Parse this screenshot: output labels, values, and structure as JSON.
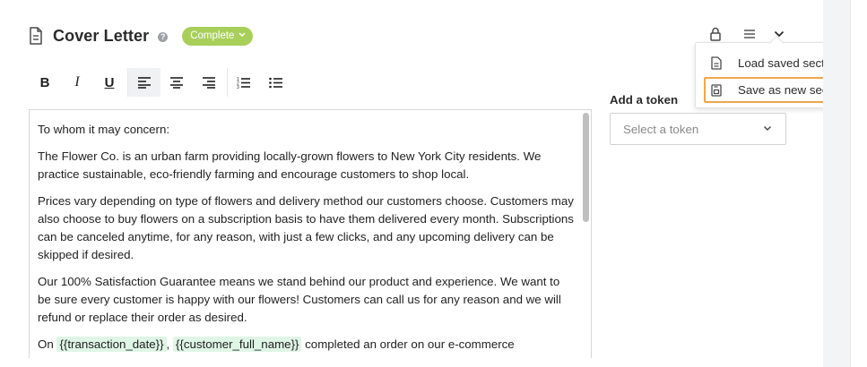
{
  "header": {
    "title": "Cover Letter",
    "help_icon": "?",
    "status": "Complete",
    "accent_color": "#a8cf5a"
  },
  "header_actions": {
    "icons": [
      "lock-icon",
      "menu-icon",
      "chevron-down-icon"
    ]
  },
  "toolbar": {
    "bold": "B",
    "italic": "I",
    "underline": "U",
    "active_tool": "align-left"
  },
  "editor": {
    "paragraphs": [
      "To whom it may concern:",
      "The Flower Co. is an urban farm providing locally-grown flowers to New York City residents. We practice sustainable, eco-friendly farming and encourage customers to shop local.",
      "Prices vary depending on type of flowers and delivery method our customers choose. Customers may also choose to buy flowers on a subscription basis to have them delivered every month. Subscriptions can be canceled anytime, for any reason, with just a few clicks, and any upcoming delivery can be skipped if desired.",
      "Our 100% Satisfaction Guarantee means we stand behind our product and experience. We want to be sure every customer is happy with our flowers! Customers can call us for any reason and we will refund or replace their order as desired."
    ],
    "last_line": {
      "lead": "On",
      "token1": "{{transaction_date}}",
      "comma": ",",
      "token2": "{{customer_full_name}}",
      "tail": "completed an order on our e-commerce"
    }
  },
  "token_panel": {
    "label": "Add a token",
    "placeholder": "Select a token"
  },
  "dropdown_menu": {
    "items": [
      {
        "label": "Load saved section",
        "icon": "document-icon"
      },
      {
        "label": "Save as new section",
        "icon": "save-icon",
        "highlight_color": "#f0a64c"
      }
    ]
  }
}
